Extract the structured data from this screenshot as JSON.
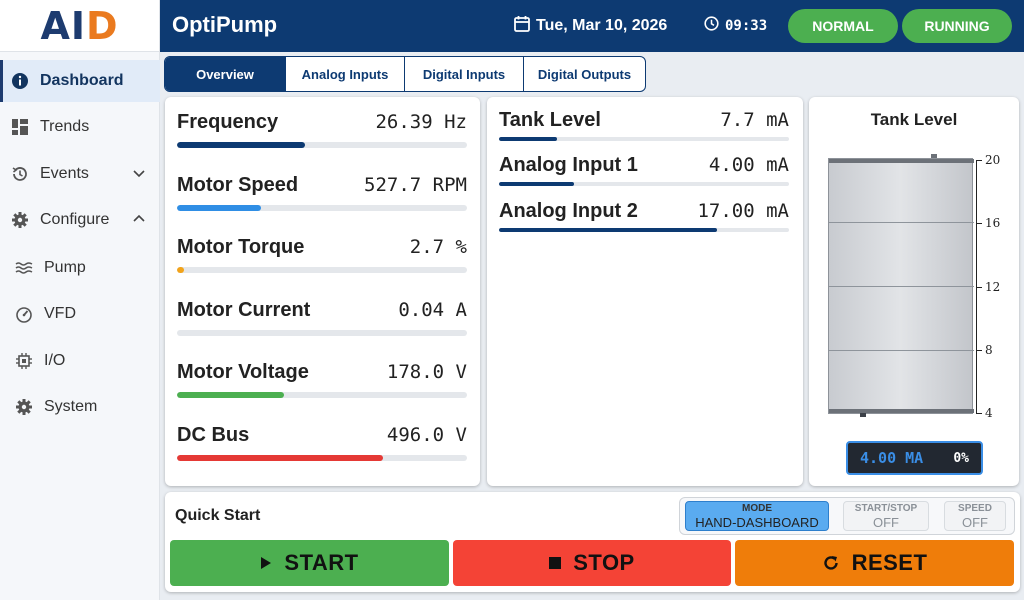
{
  "sidebar": {
    "logo_main": "AI",
    "logo_accent": "D",
    "items": [
      {
        "label": "Dashboard",
        "icon": "info-icon"
      },
      {
        "label": "Trends",
        "icon": "grid-icon"
      },
      {
        "label": "Events",
        "icon": "history-icon"
      },
      {
        "label": "Configure",
        "icon": "gear-icon"
      },
      {
        "label": "Pump",
        "icon": "waves-icon"
      },
      {
        "label": "VFD",
        "icon": "gauge-icon"
      },
      {
        "label": "I/O",
        "icon": "chip-icon"
      },
      {
        "label": "System",
        "icon": "gear-icon"
      }
    ]
  },
  "header": {
    "title": "OptiPump",
    "date": "Tue, Mar 10, 2026",
    "time": "09:33",
    "status_pills": [
      "NORMAL",
      "RUNNING"
    ]
  },
  "tabs": [
    "Overview",
    "Analog Inputs",
    "Digital Inputs",
    "Digital Outputs"
  ],
  "motor_metrics": [
    {
      "label": "Frequency",
      "value": "26.39 Hz",
      "fraction": 0.44,
      "color": "#0d3a72"
    },
    {
      "label": "Motor Speed",
      "value": "527.7 RPM",
      "fraction": 0.29,
      "color": "#2f8ee5"
    },
    {
      "label": "Motor Torque",
      "value": "2.7 %",
      "fraction": 0.027,
      "color": "#f2a31a"
    },
    {
      "label": "Motor Current",
      "value": "0.04 A",
      "fraction": 0.0,
      "color": "#0d3a72"
    },
    {
      "label": "Motor Voltage",
      "value": "178.0 V",
      "fraction": 0.37,
      "color": "#4caf50"
    },
    {
      "label": "DC Bus",
      "value": "496.0 V",
      "fraction": 0.71,
      "color": "#e53935"
    }
  ],
  "analog_metrics": [
    {
      "label": "Tank Level",
      "value": "7.7 mA",
      "fraction": 0.2,
      "color": "#0d3a72"
    },
    {
      "label": "Analog Input 1",
      "value": "4.00 mA",
      "fraction": 0.26,
      "color": "#0d3a72"
    },
    {
      "label": "Analog Input 2",
      "value": "17.00 mA",
      "fraction": 0.75,
      "color": "#0d3a72"
    }
  ],
  "tank": {
    "title": "Tank Level",
    "ticks": [
      "20",
      "16",
      "12",
      "8",
      "4"
    ],
    "tick_values": [
      20,
      16,
      12,
      8,
      4
    ],
    "scale_min": 4,
    "scale_max": 20,
    "fill_fraction": 0.0,
    "readout_value": "4.00 MA",
    "readout_percent": "0%"
  },
  "quick_start": {
    "title": "Quick Start",
    "status": [
      {
        "label": "MODE",
        "value": "HAND-DASHBOARD",
        "active": true
      },
      {
        "label": "START/STOP",
        "value": "OFF",
        "active": false
      },
      {
        "label": "SPEED",
        "value": "OFF",
        "active": false
      }
    ],
    "buttons": [
      {
        "label": "START",
        "color": "#4caf50",
        "icon": "play-icon"
      },
      {
        "label": "STOP",
        "color": "#f44336",
        "icon": "stop-icon"
      },
      {
        "label": "RESET",
        "color": "#ef7d0a",
        "icon": "refresh-icon"
      }
    ]
  },
  "colors": {
    "brand": "#0d3a72",
    "accent": "#ea7a1f",
    "ok": "#4caf50"
  }
}
